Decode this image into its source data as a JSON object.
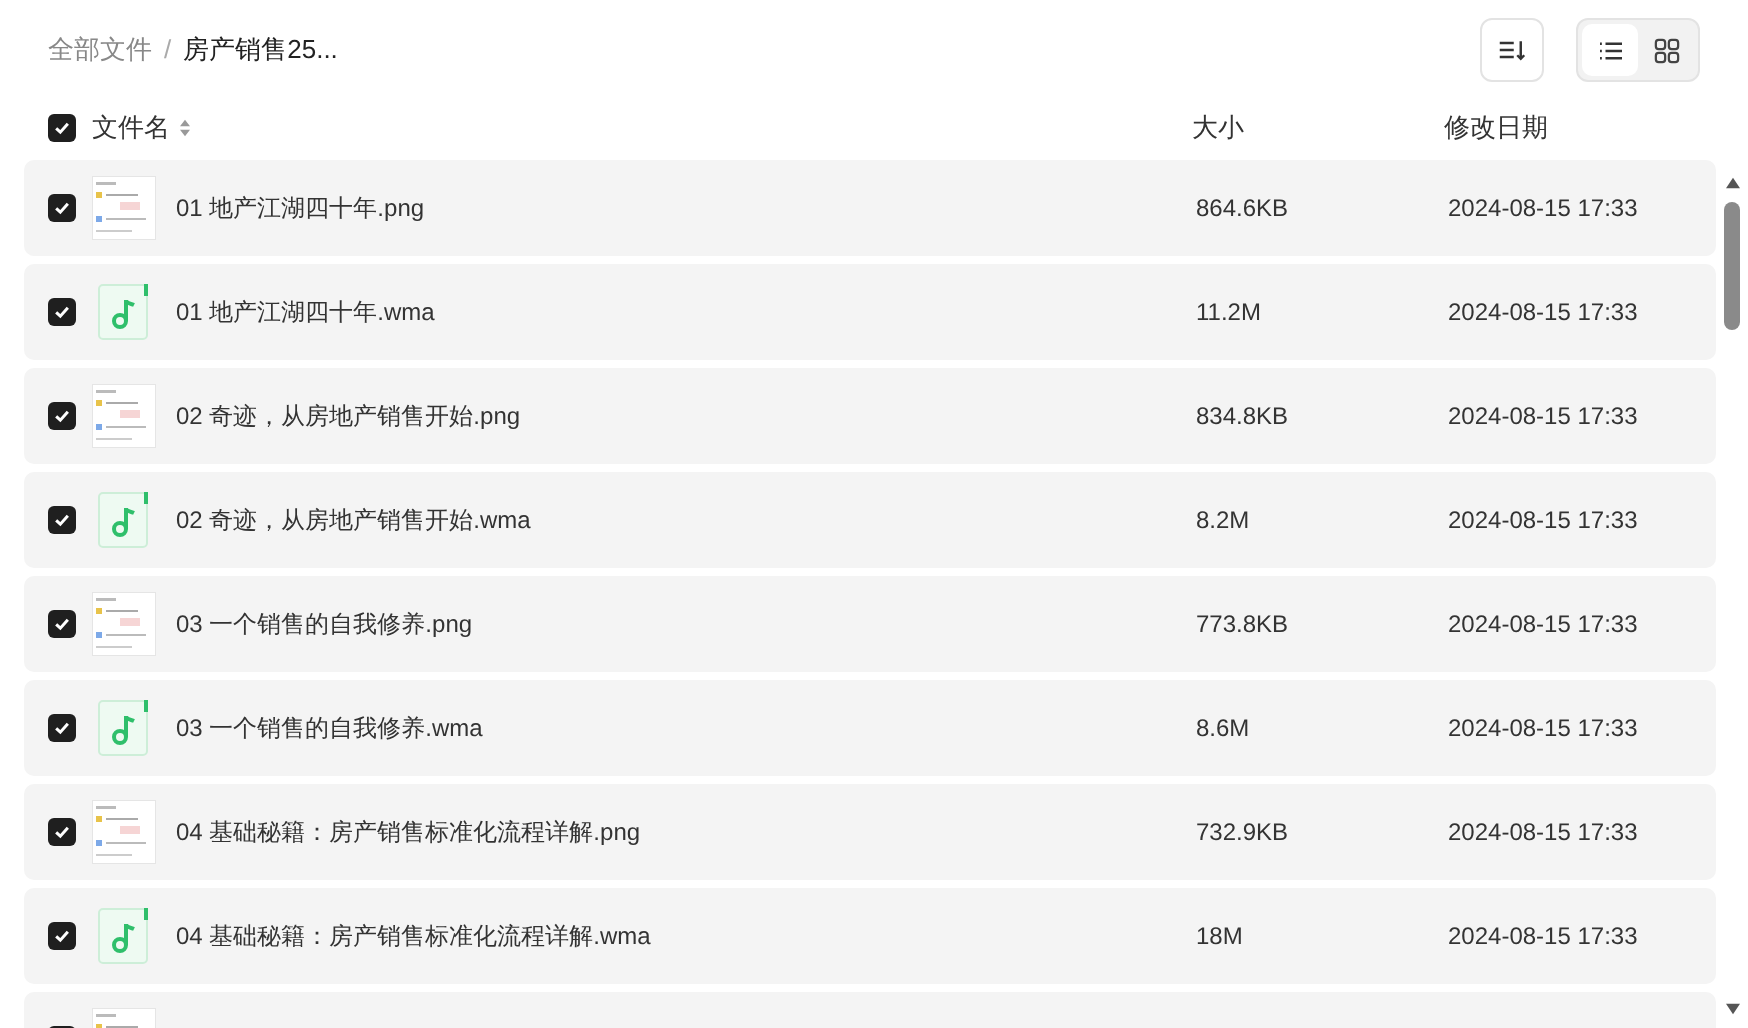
{
  "breadcrumb": [
    {
      "label": "全部文件",
      "current": false
    },
    {
      "label": "房产销售25...",
      "current": true
    }
  ],
  "breadcrumb_separator": "/",
  "view_modes": [
    {
      "kind": "list",
      "selected": true
    },
    {
      "kind": "grid",
      "selected": false
    }
  ],
  "header": {
    "checked": true,
    "columns": [
      {
        "label": "文件名",
        "sortable": true
      },
      {
        "label": "大小",
        "sortable": false
      },
      {
        "label": "修改日期",
        "sortable": false
      }
    ]
  },
  "rows": [
    {
      "kind": "image",
      "checked": true,
      "name": "01 地产江湖四十年.png",
      "size": "864.6KB",
      "modified": "2024-08-15 17:33"
    },
    {
      "kind": "audio",
      "checked": true,
      "name": "01 地产江湖四十年.wma",
      "size": "11.2M",
      "modified": "2024-08-15 17:33"
    },
    {
      "kind": "image",
      "checked": true,
      "name": "02 奇迹，从房地产销售开始.png",
      "size": "834.8KB",
      "modified": "2024-08-15 17:33"
    },
    {
      "kind": "audio",
      "checked": true,
      "name": "02 奇迹，从房地产销售开始.wma",
      "size": "8.2M",
      "modified": "2024-08-15 17:33"
    },
    {
      "kind": "image",
      "checked": true,
      "name": "03 一个销售的自我修养.png",
      "size": "773.8KB",
      "modified": "2024-08-15 17:33"
    },
    {
      "kind": "audio",
      "checked": true,
      "name": "03 一个销售的自我修养.wma",
      "size": "8.6M",
      "modified": "2024-08-15 17:33"
    },
    {
      "kind": "image",
      "checked": true,
      "name": "04 基础秘籍：房产销售标准化流程详解.png",
      "size": "732.9KB",
      "modified": "2024-08-15 17:33"
    },
    {
      "kind": "audio",
      "checked": true,
      "name": "04 基础秘籍：房产销售标准化流程详解.wma",
      "size": "18M",
      "modified": "2024-08-15 17:33"
    },
    {
      "kind": "image",
      "checked": true
    }
  ]
}
